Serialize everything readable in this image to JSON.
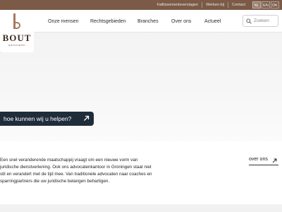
{
  "topbar": {
    "links": [
      "Faillissementsverslagen",
      "Werken bij",
      "Contact"
    ],
    "languages": [
      "NL",
      "EN",
      "DK"
    ]
  },
  "logo": {
    "name": "BOUT",
    "subtitle": "advocaten"
  },
  "nav": {
    "items": [
      "Onze mensen",
      "Rechtsgebieden",
      "Branches",
      "Over ons",
      "Actueel"
    ]
  },
  "search": {
    "placeholder": "Zoeken",
    "icon": "search-icon"
  },
  "hero": {
    "cta_label": "hoe kunnen wij u helpen?",
    "cta_icon": "arrow-up-right-icon"
  },
  "intro": {
    "lines": [
      "Een snel veranderende maatschappij vraagt om een nieuwe vorm van",
      "juridische dienstverlening. Ook ons advocatenkantoor in Groningen staat niet",
      "stil en verandert met de tijd mee. Van traditionele advocaten naar coaches en",
      "sparringpartners die uw juridische belangen behartigen."
    ]
  },
  "about_link": {
    "label": "over ons",
    "icon": "arrow-up-right-icon"
  },
  "colors": {
    "topbar": "#7b5a48",
    "cta": "#1f2c3a",
    "logo_text": "#3f2c22"
  }
}
